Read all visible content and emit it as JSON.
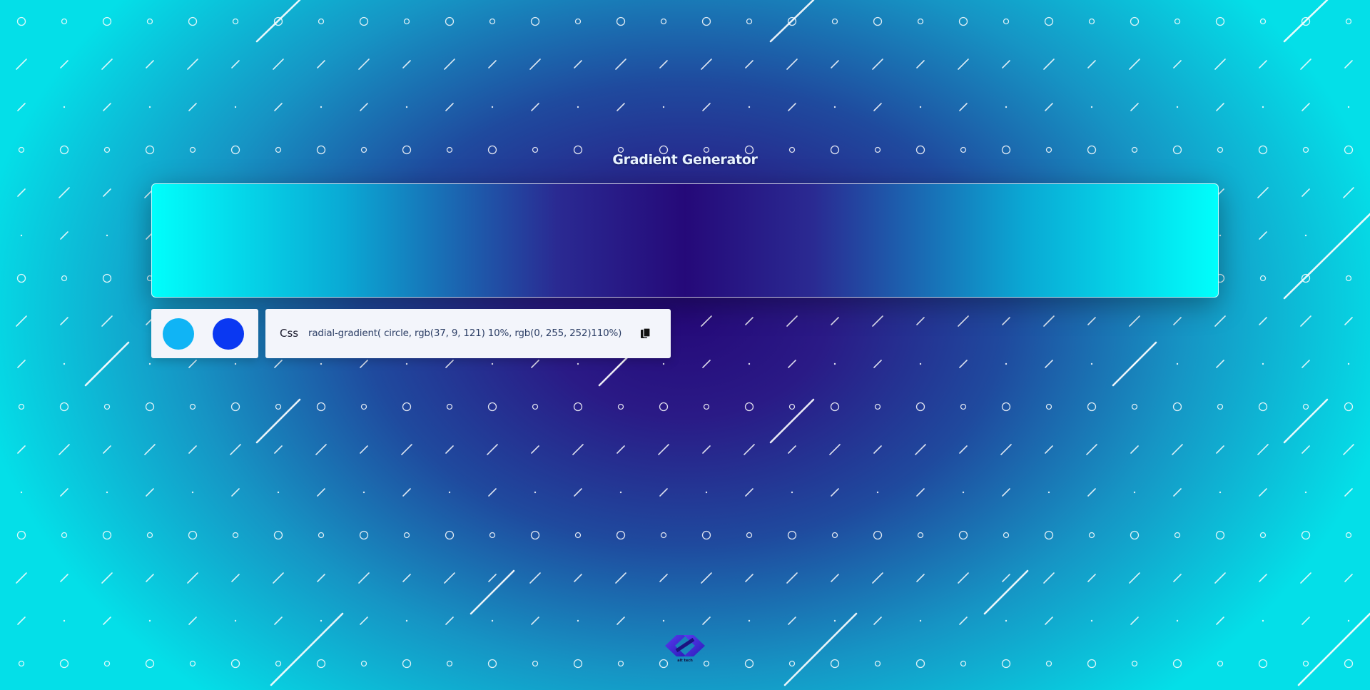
{
  "header": {
    "title": "Gradient Generator"
  },
  "preview": {
    "gradient_css": "radial-gradient( circle, rgb(37, 9, 121) 10%, rgb(0, 255, 252)110%)",
    "stop_1_color": "#250979",
    "stop_2_color": "#00fffc"
  },
  "swatches": [
    {
      "color": "#10b4f5"
    },
    {
      "color": "#0a38f2"
    }
  ],
  "css_output": {
    "label": "Css",
    "code": "radial-gradient( circle, rgb(37, 9, 121) 10%, rgb(0, 255, 252)110%)",
    "copy_icon": "copy-icon"
  },
  "footer": {
    "logo_icon": "brand-logo-icon",
    "logo_text": "alt tech",
    "logo_color": "#3a2bd8"
  }
}
